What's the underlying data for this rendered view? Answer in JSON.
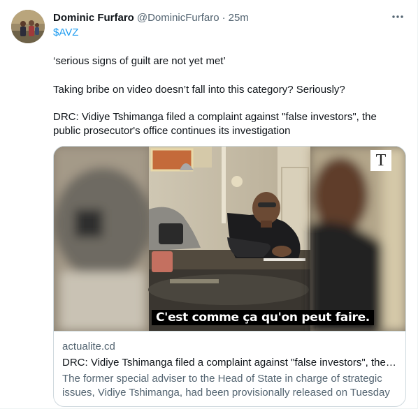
{
  "tweet": {
    "display_name": "Dominic Furfaro",
    "handle": "@DominicFurfaro",
    "separator": "·",
    "time": "25m",
    "cashtag": "$AVZ",
    "paragraphs": [
      "‘serious signs of guilt are not yet met’",
      "Taking bribe on video doesn’t fall into this category? Seriously?",
      "DRC: Vidiye Tshimanga filed a complaint against \"false investors\", the public prosecutor's office continues its investigation"
    ],
    "more_icon": "more-horizontal-icon",
    "avatar_icon": "avatar"
  },
  "card": {
    "video_subtitle": "C'est comme ça qu'on peut faire.",
    "logo_letter": "T",
    "domain": "actualite.cd",
    "title": "DRC: Vidiye Tshimanga filed a complaint against \"false investors\", the ...",
    "description": "The former special adviser to the Head of State in charge of strategic issues, Vidiye Tshimanga, had been provisionally released on Tuesday ..."
  },
  "colors": {
    "link": "#1d9bf0",
    "secondary_text": "#536471",
    "primary_text": "#0f1419",
    "border": "#cfd9de"
  }
}
